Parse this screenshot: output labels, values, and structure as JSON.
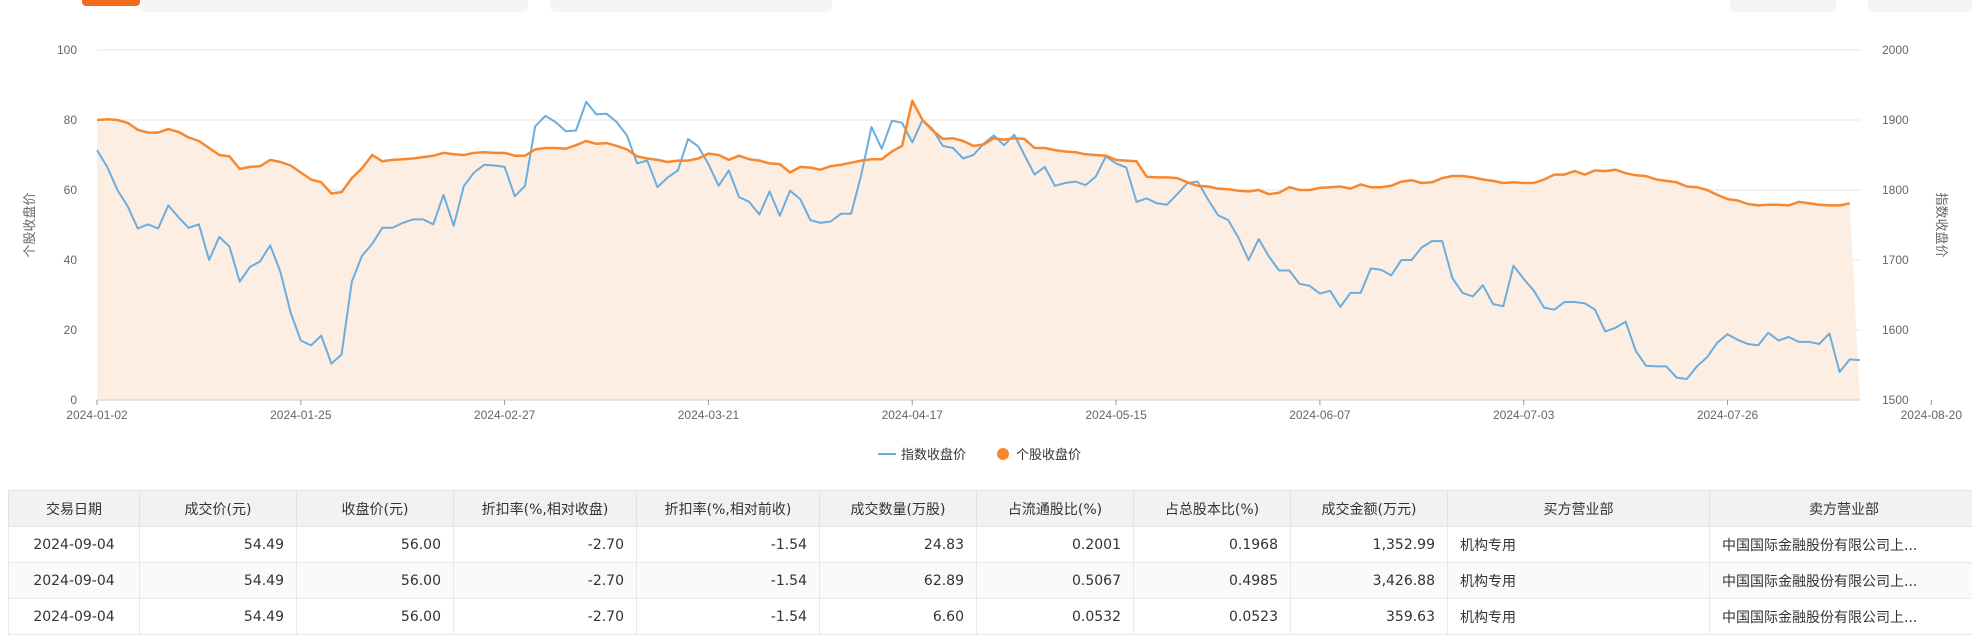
{
  "colors": {
    "accent": "#f26b1d",
    "index_line": "#6aaee0",
    "stock_line": "#f7882f",
    "area_fill": "#fdeee3"
  },
  "chart_data": {
    "type": "line",
    "x_tick_labels": [
      "2024-01-02",
      "2024-01-25",
      "2024-02-27",
      "2024-03-21",
      "2024-04-17",
      "2024-05-15",
      "2024-06-07",
      "2024-07-03",
      "2024-07-26",
      "2024-08-20"
    ],
    "x_tick_index": [
      0,
      20,
      40,
      60,
      80,
      100,
      120,
      140,
      160,
      180
    ],
    "y_left": {
      "label": "个股收盘价",
      "ticks": [
        "0",
        "20",
        "40",
        "60",
        "80",
        "100"
      ],
      "lim": [
        0,
        100
      ]
    },
    "y_right": {
      "label": "指数收盘价",
      "ticks": [
        "1500",
        "1600",
        "1700",
        "1800",
        "1900",
        "2000"
      ],
      "lim": [
        1500,
        2000
      ]
    },
    "grid": true,
    "legend_position": "bottom-center",
    "series": [
      {
        "name": "指数收盘价",
        "axis": "right",
        "values": [
          1857,
          1833,
          1800,
          1777,
          1745,
          1751,
          1745,
          1778,
          1761,
          1746,
          1751,
          1700,
          1733,
          1719,
          1669,
          1690,
          1698,
          1721,
          1683,
          1625,
          1585,
          1578,
          1592,
          1552,
          1565,
          1669,
          1706,
          1723,
          1746,
          1746,
          1753,
          1758,
          1758,
          1751,
          1793,
          1749,
          1806,
          1825,
          1836,
          1835,
          1833,
          1791,
          1806,
          1891,
          1906,
          1897,
          1884,
          1885,
          1926,
          1908,
          1909,
          1897,
          1878,
          1838,
          1842,
          1804,
          1818,
          1828,
          1873,
          1862,
          1837,
          1806,
          1828,
          1790,
          1783,
          1765,
          1798,
          1763,
          1799,
          1787,
          1757,
          1753,
          1755,
          1766,
          1766,
          1822,
          1890,
          1859,
          1899,
          1896,
          1868,
          1900,
          1887,
          1863,
          1860,
          1845,
          1850,
          1866,
          1878,
          1864,
          1879,
          1850,
          1822,
          1833,
          1806,
          1810,
          1812,
          1807,
          1819,
          1848,
          1838,
          1832,
          1783,
          1788,
          1781,
          1779,
          1794,
          1810,
          1812,
          1787,
          1764,
          1757,
          1732,
          1700,
          1730,
          1705,
          1685,
          1685,
          1666,
          1663,
          1652,
          1656,
          1633,
          1653,
          1653,
          1688,
          1686,
          1678,
          1700,
          1700,
          1718,
          1727,
          1727,
          1674,
          1653,
          1648,
          1664,
          1637,
          1634,
          1692,
          1673,
          1656,
          1632,
          1629,
          1640,
          1640,
          1638,
          1629,
          1598,
          1603,
          1612,
          1570,
          1549,
          1548,
          1548,
          1532,
          1530,
          1548,
          1561,
          1582,
          1594,
          1586,
          1580,
          1578,
          1596,
          1585,
          1590,
          1583,
          1583,
          1580,
          1595,
          1540,
          1558,
          1557
        ]
      },
      {
        "name": "个股收盘价",
        "axis": "left",
        "values": [
          80,
          80.2,
          80,
          79.2,
          77.2,
          76.4,
          76.4,
          77.4,
          76.6,
          75,
          74,
          72,
          70,
          69.6,
          66,
          66.6,
          66.8,
          68.6,
          68,
          67,
          65,
          63,
          62.2,
          59,
          59.4,
          63.4,
          66.2,
          70,
          68.2,
          68.6,
          68.8,
          69,
          69.4,
          69.8,
          70.6,
          70.2,
          70,
          70.6,
          70.8,
          70.6,
          70.6,
          69.8,
          69.8,
          71.6,
          72,
          72,
          71.8,
          72.8,
          74,
          73.2,
          73.4,
          72.6,
          71.6,
          69.6,
          69,
          68.6,
          68,
          68.4,
          68.4,
          69,
          70.4,
          70,
          68.6,
          69.8,
          68.8,
          68.4,
          67.6,
          67.4,
          65,
          66.6,
          66.4,
          65.8,
          66.8,
          67.2,
          67.8,
          68.4,
          68.8,
          68.8,
          71,
          72.6,
          85.5,
          80,
          77,
          74.6,
          74.8,
          74,
          72.6,
          73,
          74.8,
          74.4,
          74.8,
          74.6,
          72,
          72,
          71.4,
          71,
          70.8,
          70.2,
          70,
          69.8,
          68.6,
          68.4,
          68.2,
          63.8,
          63.6,
          63.6,
          63.4,
          62.2,
          61.2,
          61,
          60.4,
          60.2,
          59.8,
          59.6,
          60,
          58.8,
          59.2,
          60.8,
          60,
          60,
          60.6,
          60.8,
          61,
          60.4,
          61.6,
          60.8,
          60.8,
          61.2,
          62.4,
          62.8,
          62,
          62.2,
          63.4,
          64,
          64,
          63.6,
          63,
          62.6,
          62,
          62.2,
          62,
          62,
          63,
          64.4,
          64.4,
          65.4,
          64.4,
          65.6,
          65.4,
          65.8,
          64.8,
          64.2,
          64,
          63,
          62.6,
          62.2,
          61,
          60.8,
          60,
          58.6,
          57.4,
          57,
          56,
          55.6,
          55.8,
          55.8,
          55.6,
          56.6,
          56.2,
          55.8,
          55.6,
          55.6,
          56.2
        ]
      }
    ]
  },
  "table": {
    "headers": [
      "交易日期",
      "成交价(元)",
      "收盘价(元)",
      "折扣率(%,相对收盘)",
      "折扣率(%,相对前收)",
      "成交数量(万股)",
      "占流通股比(%)",
      "占总股本比(%)",
      "成交金额(万元)",
      "买方营业部",
      "卖方营业部"
    ],
    "rows": [
      [
        "2024-09-04",
        "54.49",
        "56.00",
        "-2.70",
        "-1.54",
        "24.83",
        "0.2001",
        "0.1968",
        "1,352.99",
        "机构专用",
        "中国国际金融股份有限公司上..."
      ],
      [
        "2024-09-04",
        "54.49",
        "56.00",
        "-2.70",
        "-1.54",
        "62.89",
        "0.5067",
        "0.4985",
        "3,426.88",
        "机构专用",
        "中国国际金融股份有限公司上..."
      ],
      [
        "2024-09-04",
        "54.49",
        "56.00",
        "-2.70",
        "-1.54",
        "6.60",
        "0.0532",
        "0.0523",
        "359.63",
        "机构专用",
        "中国国际金融股份有限公司上..."
      ]
    ]
  }
}
